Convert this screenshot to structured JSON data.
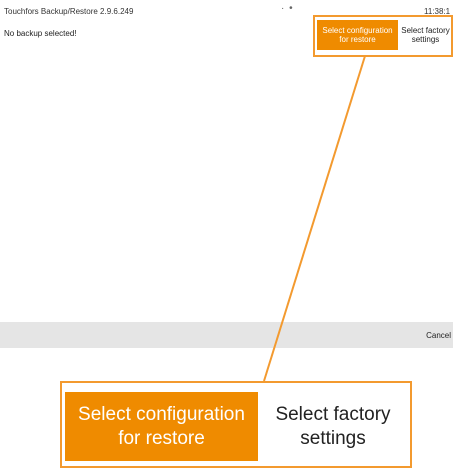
{
  "app": {
    "title": "Touchfors Backup/Restore 2.9.6.249",
    "page_indicator": "· •",
    "time": "11:38:1"
  },
  "main": {
    "status": "No backup selected!"
  },
  "actions": {
    "select_configuration": "Select configuration for restore",
    "select_factory": "Select factory settings"
  },
  "footer": {
    "cancel": "Cancel"
  },
  "callout": {
    "select_configuration": "Select configuration for restore",
    "select_factory": "Select factory settings"
  },
  "colors": {
    "accent": "#ef8b00",
    "highlight": "#f39a2f",
    "footer_bg": "#e5e5e5"
  }
}
